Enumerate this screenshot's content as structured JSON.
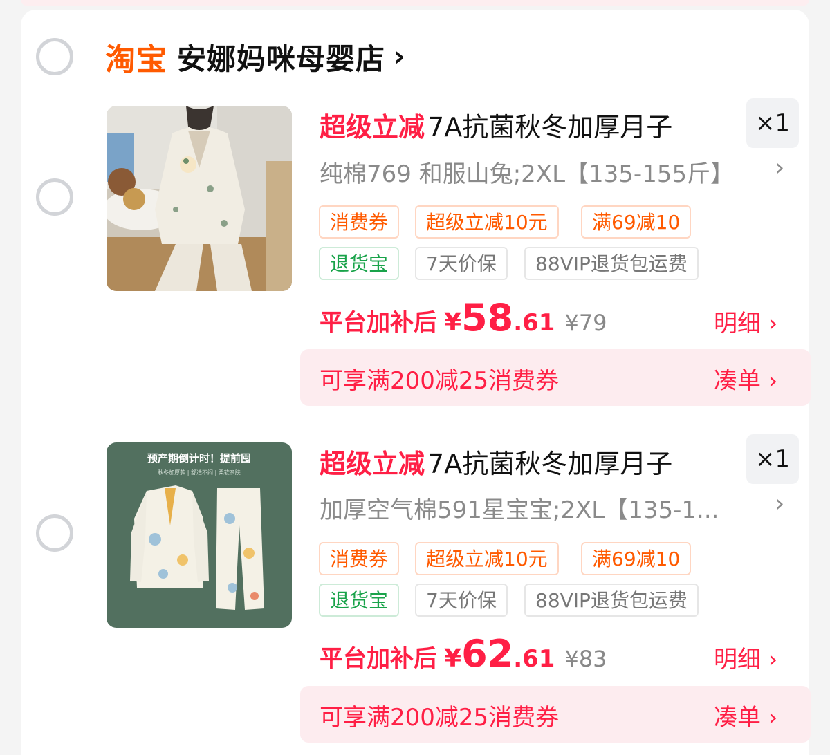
{
  "shop": {
    "platform_logo": "淘宝",
    "name": "安娜妈咪母婴店",
    "chevron": "›"
  },
  "items": [
    {
      "promo_tag": "超级立减",
      "title": "7A抗菌秋冬加厚月子",
      "quantity": "×1",
      "sku": "纯棉769 和服山兔;2XL【135-155斤】",
      "sku_chevron": "›",
      "tags_row1": [
        "消费券",
        "超级立减10元",
        "满69减10"
      ],
      "tags_row2": [
        "退货宝",
        "7天价保",
        "88VIP退货包运费"
      ],
      "price_label": "平台加补后",
      "currency": "¥",
      "price_int": "58",
      "price_dec": ".61",
      "original_price": "¥79",
      "detail_label": "明细 ›",
      "coupon_text": "可享满200减25消费券",
      "coupon_action": "凑单 ›",
      "image_icon": "pajama-photo-icon"
    },
    {
      "promo_tag": "超级立减",
      "title": "7A抗菌秋冬加厚月子",
      "quantity": "×1",
      "sku": "加厚空气棉591星宝宝;2XL【135-1...",
      "sku_chevron": "›",
      "tags_row1": [
        "消费券",
        "超级立减10元",
        "满69减10"
      ],
      "tags_row2": [
        "退货宝",
        "7天价保",
        "88VIP退货包运费"
      ],
      "price_label": "平台加补后",
      "currency": "¥",
      "price_int": "62",
      "price_dec": ".61",
      "original_price": "¥83",
      "detail_label": "明细 ›",
      "coupon_text": "可享满200减25消费券",
      "coupon_action": "凑单 ›",
      "image_caption": "预产期倒计时！提前囤",
      "image_subcaption": "秋冬加厚款 | 舒适不闷 | 柔软亲肤",
      "image_icon": "pajama-product-icon"
    }
  ],
  "colors": {
    "accent_red": "#ff1f45",
    "taobao_orange": "#ff5a00",
    "green_tag": "#19a34a",
    "coupon_bg": "#fdecef"
  }
}
